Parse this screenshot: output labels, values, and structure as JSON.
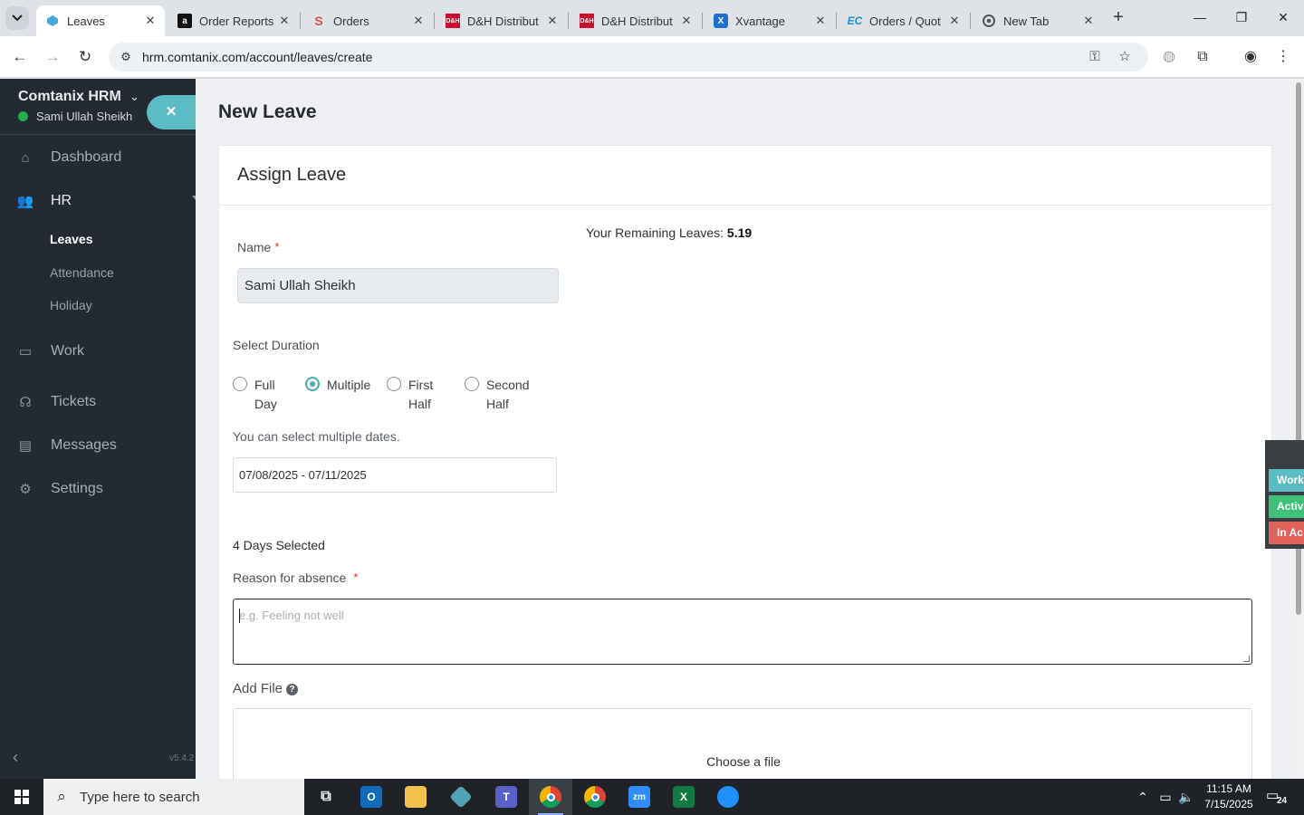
{
  "browser": {
    "tabs": [
      {
        "label": "Leaves",
        "icon": "comtanix-icon",
        "active": true
      },
      {
        "label": "Order Reports",
        "icon": "amazon-icon"
      },
      {
        "label": "Orders",
        "icon": "orders-icon"
      },
      {
        "label": "D&H Distribut",
        "icon": "dh-icon"
      },
      {
        "label": "D&H Distribut",
        "icon": "dh-icon"
      },
      {
        "label": "Xvantage",
        "icon": "xvantage-icon"
      },
      {
        "label": "Orders / Quot",
        "icon": "ec-icon"
      },
      {
        "label": "New Tab",
        "icon": "chrome-icon"
      }
    ],
    "url": "hrm.comtanix.com/account/leaves/create"
  },
  "sidebar": {
    "brand": "Comtanix HRM",
    "user": "Sami Ullah Sheikh",
    "nav": [
      {
        "label": "Dashboard",
        "icon": "home-icon"
      },
      {
        "label": "HR",
        "icon": "users-icon"
      },
      {
        "label": "Work",
        "icon": "briefcase-icon"
      },
      {
        "label": "Tickets",
        "icon": "headset-icon"
      },
      {
        "label": "Messages",
        "icon": "chat-icon"
      },
      {
        "label": "Settings",
        "icon": "gear-icon"
      }
    ],
    "hr_sub": [
      "Leaves",
      "Attendance",
      "Holiday"
    ],
    "version": "v5.4.2"
  },
  "page": {
    "title": "New Leave",
    "card_title": "Assign Leave",
    "name_label": "Name",
    "name_value": "Sami Ullah Sheikh",
    "remaining_label": "Your Remaining Leaves:",
    "remaining_value": "5.19",
    "duration_label": "Select Duration",
    "durations": [
      {
        "line1": "Full",
        "line2": "Day",
        "checked": false
      },
      {
        "line1": "Multiple",
        "line2": "",
        "checked": true
      },
      {
        "line1": "First",
        "line2": "Half",
        "checked": false
      },
      {
        "line1": "Second",
        "line2": "Half",
        "checked": false
      }
    ],
    "multi_hint": "You can select multiple dates.",
    "date_range": "07/08/2025 - 07/11/2025",
    "days_selected": "4 Days Selected",
    "reason_label": "Reason for absence",
    "reason_placeholder": "e.g. Feeling not well",
    "add_file_label": "Add File",
    "choose_file": "Choose a file"
  },
  "status_widget": [
    {
      "label": "Work",
      "color": "#5bbcc4"
    },
    {
      "label": "Activ",
      "color": "#3ec07a"
    },
    {
      "label": "In Ac",
      "color": "#e2625c"
    }
  ],
  "taskbar": {
    "search_placeholder": "Type here to search",
    "time": "11:15 AM",
    "date": "7/15/2025",
    "notification_count": "24"
  }
}
